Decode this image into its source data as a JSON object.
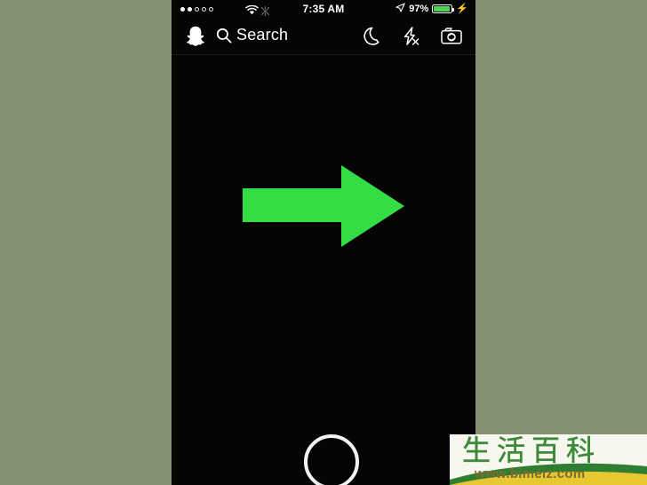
{
  "background": {
    "color": "#849273"
  },
  "phone": {
    "screen_color": "#050505",
    "status_bar": {
      "signal_dots_filled": 2,
      "signal_dots_total": 5,
      "wifi_icon": "wifi-icon",
      "sync_icon": "sync-disabled-icon",
      "time": "7:35 AM",
      "location_icon": "location-arrow-icon",
      "battery_percent": "97%",
      "battery_fill_color": "#4cd551",
      "charging_icon": "lightning-bolt-icon"
    },
    "app_bar": {
      "ghost_icon": "snapchat-ghost-icon",
      "search_icon": "search-icon",
      "search_label": "Search",
      "night_mode_icon": "moon-icon",
      "flash_off_icon": "flash-off-icon",
      "camera_flip_icon": "camera-flip-icon"
    },
    "viewfinder": {
      "capture_button": "shutter-button",
      "capture_button_color": "#f3f3f3"
    },
    "annotation": {
      "arrow_direction": "right",
      "arrow_color": "#33dd44"
    }
  },
  "watermark": {
    "title_cn": "生活百科",
    "url": "www.bimeiz.com",
    "title_color": "#3d8a3a",
    "url_color": "#7c6a2e",
    "banner_color": "#f7f6ef",
    "swoosh_green": "#2f7d33",
    "swoosh_yellow": "#e8c832"
  }
}
